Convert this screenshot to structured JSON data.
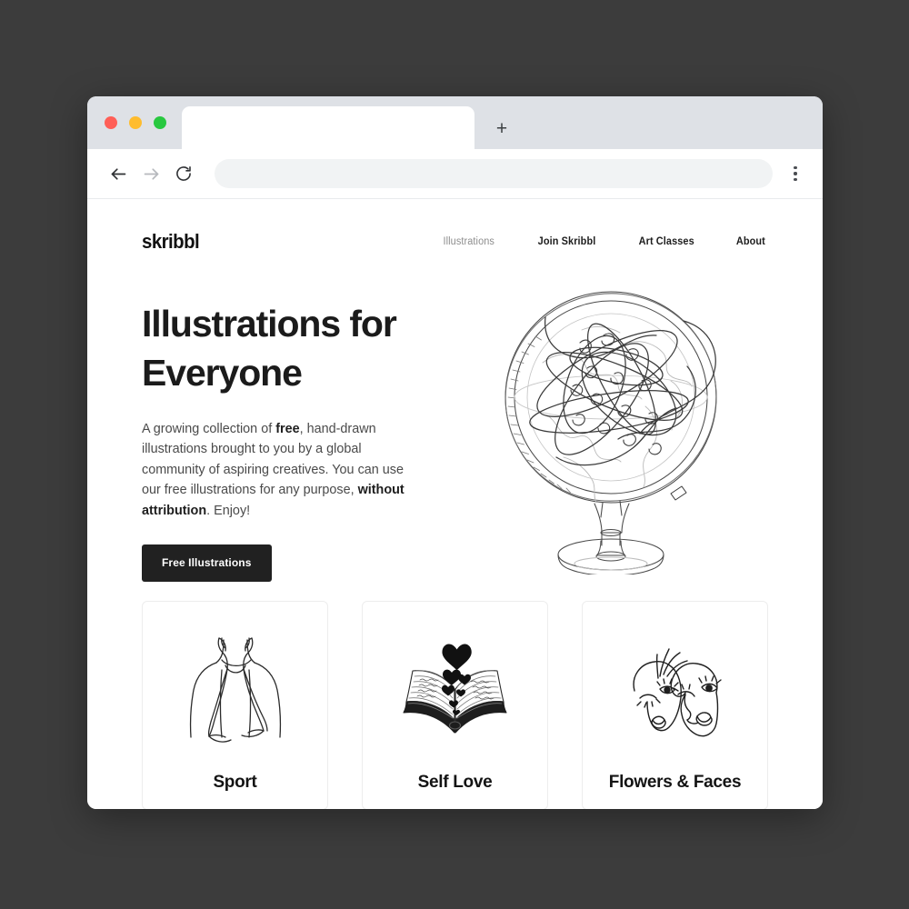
{
  "browser": {
    "traffic_lights": [
      {
        "name": "close",
        "color": "#ff5f57"
      },
      {
        "name": "minimize",
        "color": "#febc2e"
      },
      {
        "name": "maximize",
        "color": "#28c840"
      }
    ],
    "tab": {
      "title": ""
    },
    "new_tab_label": "+",
    "address_bar": {
      "value": "",
      "placeholder": ""
    },
    "back_label": "Back",
    "forward_label": "Forward",
    "reload_label": "Reload",
    "menu_label": "Menu"
  },
  "site": {
    "logo": "skribbl",
    "nav": [
      {
        "label": "Illustrations",
        "muted": true
      },
      {
        "label": "Join Skribbl",
        "muted": false
      },
      {
        "label": "Art Classes",
        "muted": false
      },
      {
        "label": "About",
        "muted": false
      }
    ],
    "hero": {
      "title_line1": "Illustrations for",
      "title_line2": "Everyone",
      "paragraph_part1": "A growing collection of ",
      "paragraph_bold1": "free",
      "paragraph_part2": ", hand-drawn illustrations brought to you by a global community of aspiring creatives. You can use our free illustrations for any purpose, ",
      "paragraph_bold2": "without attribution",
      "paragraph_part3": ". Enjoy!",
      "cta_label": "Free Illustrations",
      "artwork": "scribbled-globe-illustration"
    },
    "categories": [
      {
        "title": "Sport",
        "artwork": "torso-with-towel-illustration"
      },
      {
        "title": "Self Love",
        "artwork": "open-book-with-hearts-illustration"
      },
      {
        "title": "Flowers & Faces",
        "artwork": "two-line-art-faces-illustration"
      }
    ]
  },
  "colors": {
    "page_background": "#3c3c3c",
    "browser_chrome": "#dee1e6",
    "accent_dark": "#212121",
    "muted_text": "#8e8e8e"
  }
}
